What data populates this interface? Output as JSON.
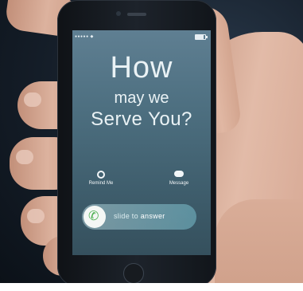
{
  "screen": {
    "status": {
      "signal_dots": "●●●●● ◆",
      "battery_level": 0.85
    },
    "headline_line1": "How",
    "headline_line2": "may we",
    "headline_line3": "Serve You?",
    "actions": [
      {
        "label": "Remind Me",
        "icon": "alarm-clock-icon"
      },
      {
        "label": "Message",
        "icon": "message-bubble-icon"
      }
    ],
    "slider": {
      "prefix": "slide to",
      "emphasis": "answer",
      "icon": "phone-handset-icon"
    }
  },
  "colors": {
    "screen_top": "#5f7f92",
    "screen_bottom": "#35505d",
    "answer_green": "#4caf50"
  }
}
